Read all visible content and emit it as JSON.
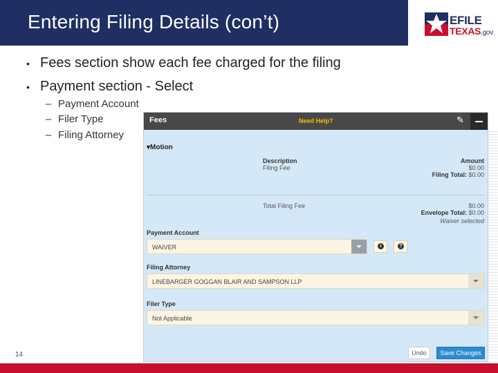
{
  "header": {
    "title": "Entering Filing Details (con’t)",
    "logo": {
      "efile": "EFILE",
      "texas": "TEXAS",
      "gov": ".gov"
    }
  },
  "bullets": [
    "Fees section show each fee charged for the filing",
    "Payment section - Select"
  ],
  "sub_bullets": [
    "Payment Account",
    "Filer Type",
    "Filing Attorney"
  ],
  "panel": {
    "title": "Fees",
    "help": "Need Help?",
    "section": "Motion",
    "description_header": "Description",
    "amount_header": "Amount",
    "fee_desc": "Filing Fee",
    "fee_amount": "$0.00",
    "filing_total_label": "Filing Total:",
    "filing_total_value": "$0.00",
    "total_filing_fee_label": "Total Filing Fee",
    "total_filing_fee_value": "$0.00",
    "envelope_total_label": "Envelope Total:",
    "envelope_total_value": "$0.00",
    "waiver_note": "Waiver selected",
    "payment_account_label": "Payment Account",
    "payment_account_value": "WAIVER",
    "filing_attorney_label": "Filing Attorney",
    "filing_attorney_value": "LINEBARGER GOGGAN BLAIR AND SAMPSON LLP",
    "filer_type_label": "Filer Type",
    "filer_type_value": "Not Applicable",
    "undo_label": "Undo",
    "save_label": "Save Changes"
  },
  "footer": {
    "page_number": "14"
  },
  "colors": {
    "banner": "#1f2f63",
    "panel_bg": "#d4e8f7",
    "panel_header": "#484848",
    "help_text": "#f5c000",
    "save_button": "#2d8bd0",
    "footer_bar": "#c8102e",
    "select_bg": "#fcf5e3"
  }
}
